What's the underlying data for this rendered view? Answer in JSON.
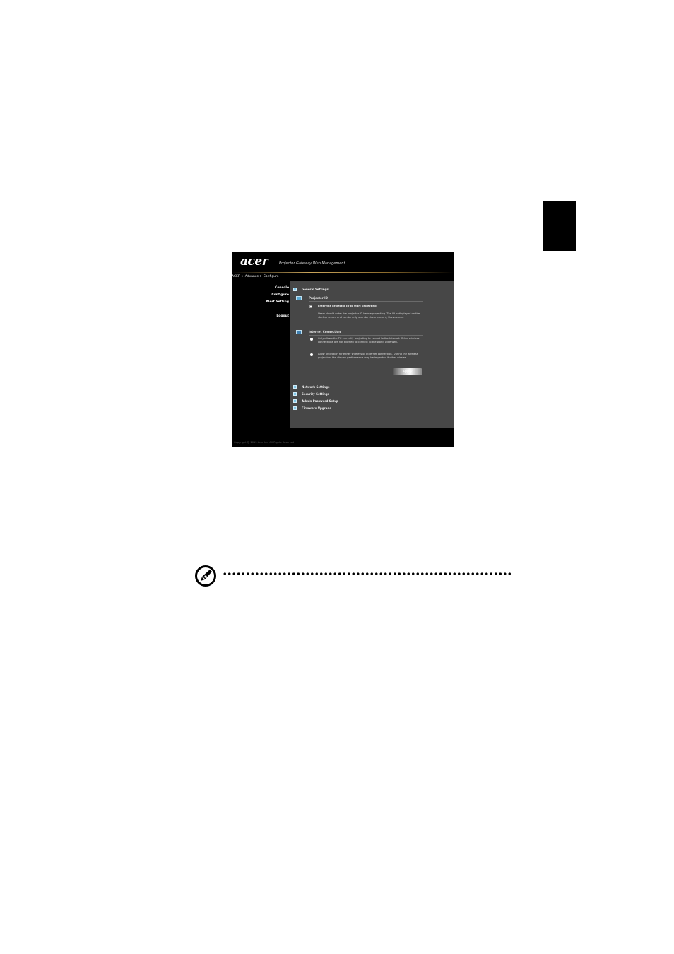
{
  "window": {
    "logo_text": "acer",
    "subtitle": "Projector Gateway Web Management",
    "breadcrumb": "ACER > Advance > Configure"
  },
  "sidebar": {
    "items": [
      {
        "label": "Console"
      },
      {
        "label": "Configure"
      },
      {
        "label": "Alert Setting"
      },
      {
        "label": "Logout"
      }
    ]
  },
  "general_settings": {
    "title": "General Settings",
    "projector_id": {
      "title": "Projector ID",
      "checkbox_label": "Enter the projector ID to start projecting.",
      "checked": false,
      "description": "Users should enter the projector ID before projecting. The ID is displayed on the startup screen and can be only seen by those present, thus determ"
    },
    "internet_connection": {
      "title": "Internet Connection",
      "option_1": "Only allows the PC currently projecting to connet to the Internet. Other wireless connections are not allowed to connect to the world wide web.",
      "option_2": "Allow projection for either wireless or Ethernet connection. During the wireless projection, the display performance may be impacted if other wireles"
    },
    "apply_label": "Apply"
  },
  "sections": [
    {
      "title": "Network Settings"
    },
    {
      "title": "Security Settings"
    },
    {
      "title": "Admin Password Setup"
    },
    {
      "title": "Firmware Upgrade"
    }
  ],
  "footer": "Copyright @ 2013 Acer Inc. All Rights Reserved",
  "icons": {
    "section_expand": "expand-square-icon",
    "projector_id": "monitor-icon",
    "internet_connection": "network-icon",
    "note": "note-pen-icon"
  },
  "colors": {
    "content_bg": "#474747",
    "window_bg": "#000000",
    "accent_gold": "#c9a45a",
    "icon_blue": "#7fc6e6"
  }
}
